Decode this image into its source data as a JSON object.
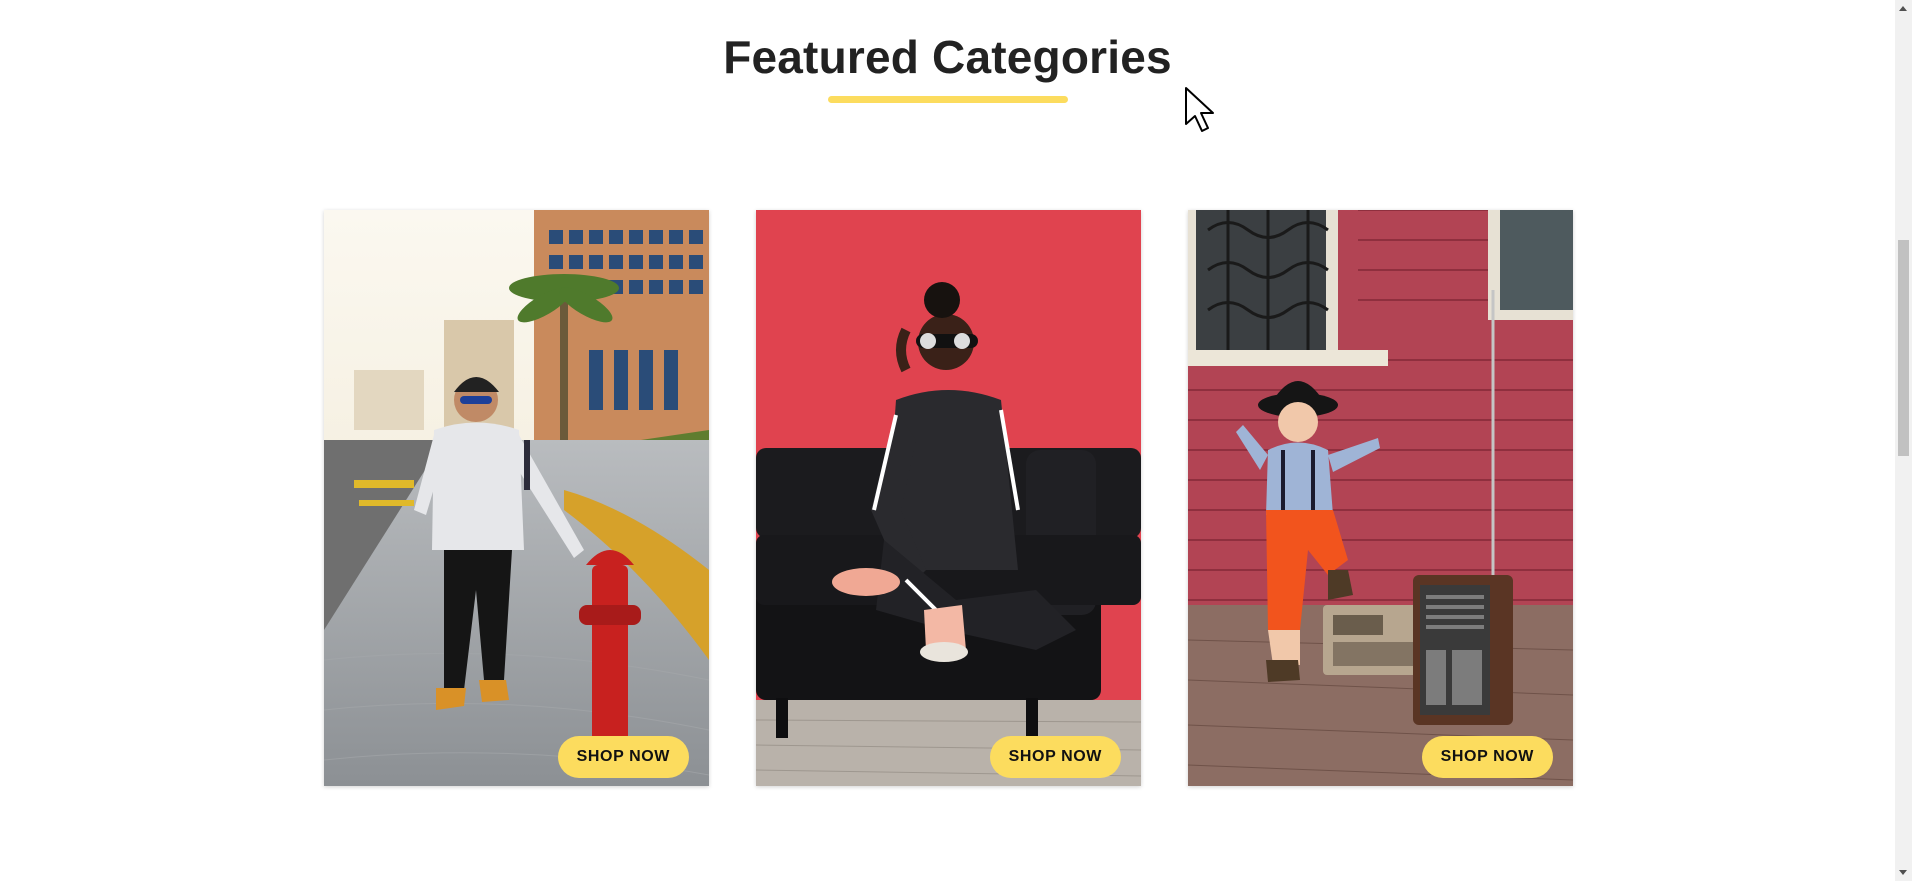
{
  "section": {
    "title": "Featured Categories",
    "accent_color": "#fcdc5e"
  },
  "cards": [
    {
      "image": "man-street-fire-hydrant-photo",
      "button_label": "SHOP NOW"
    },
    {
      "image": "woman-black-sofa-red-wall-photo",
      "button_label": "SHOP NOW"
    },
    {
      "image": "boy-brick-wall-radio-photo",
      "button_label": "SHOP NOW"
    }
  ],
  "icons": {
    "cursor": "mouse-pointer-icon"
  }
}
